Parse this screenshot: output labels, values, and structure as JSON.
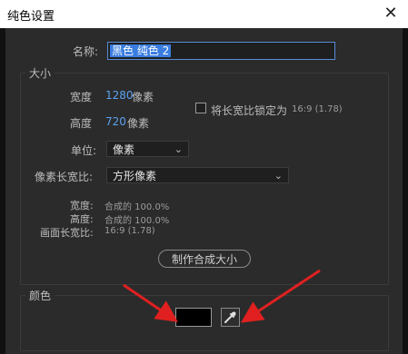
{
  "dialog": {
    "title": "纯色设置",
    "close_glyph": "✕",
    "name_label": "名称:",
    "name_value": "黑色 纯色 2",
    "size_section": "大小",
    "width_label": "宽度",
    "width_value": "1280",
    "height_label": "高度",
    "height_value": "720",
    "pixel_unit": "像素",
    "lock_ratio_label": "将长宽比锁定为",
    "lock_ratio_value": "16:9 (1.78)",
    "unit_label": "单位:",
    "unit_value": "像素",
    "pixel_aspect_label": "像素长宽比:",
    "pixel_aspect_value": "方形像素",
    "info_width_label": "宽度:",
    "info_width_value": "合成的 100.0%",
    "info_height_label": "高度:",
    "info_height_value": "合成的 100.0%",
    "info_frame_label": "画面长宽比:",
    "info_frame_value": "16:9 (1.78)",
    "make_comp_size": "制作合成大小",
    "color_section": "颜色"
  },
  "colors": {
    "swatch": "#000000",
    "accent": "#5aa1f0",
    "annotation_arrow": "#e02020"
  },
  "icons": {
    "close": "close-icon",
    "dropdown": "chevron-down-icon",
    "eyedropper": "eyedropper-icon"
  }
}
